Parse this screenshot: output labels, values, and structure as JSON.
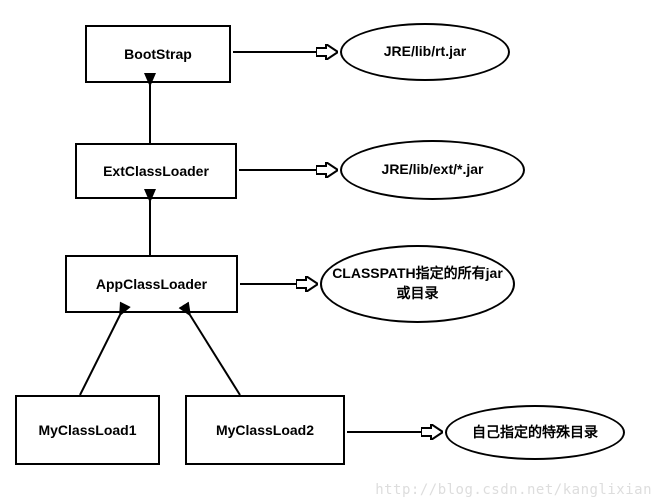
{
  "boxes": {
    "bootstrap": "BootStrap",
    "ext": "ExtClassLoader",
    "app": "AppClassLoader",
    "my1": "MyClassLoad1",
    "my2": "MyClassLoad2"
  },
  "ellipses": {
    "e1": "JRE/lib/rt.jar",
    "e2": "JRE/lib/ext/*.jar",
    "e3": "CLASSPATH指定的所有jar或目录",
    "e4": "自己指定的特殊目录"
  },
  "watermark": "http://blog.csdn.net/kanglixian"
}
